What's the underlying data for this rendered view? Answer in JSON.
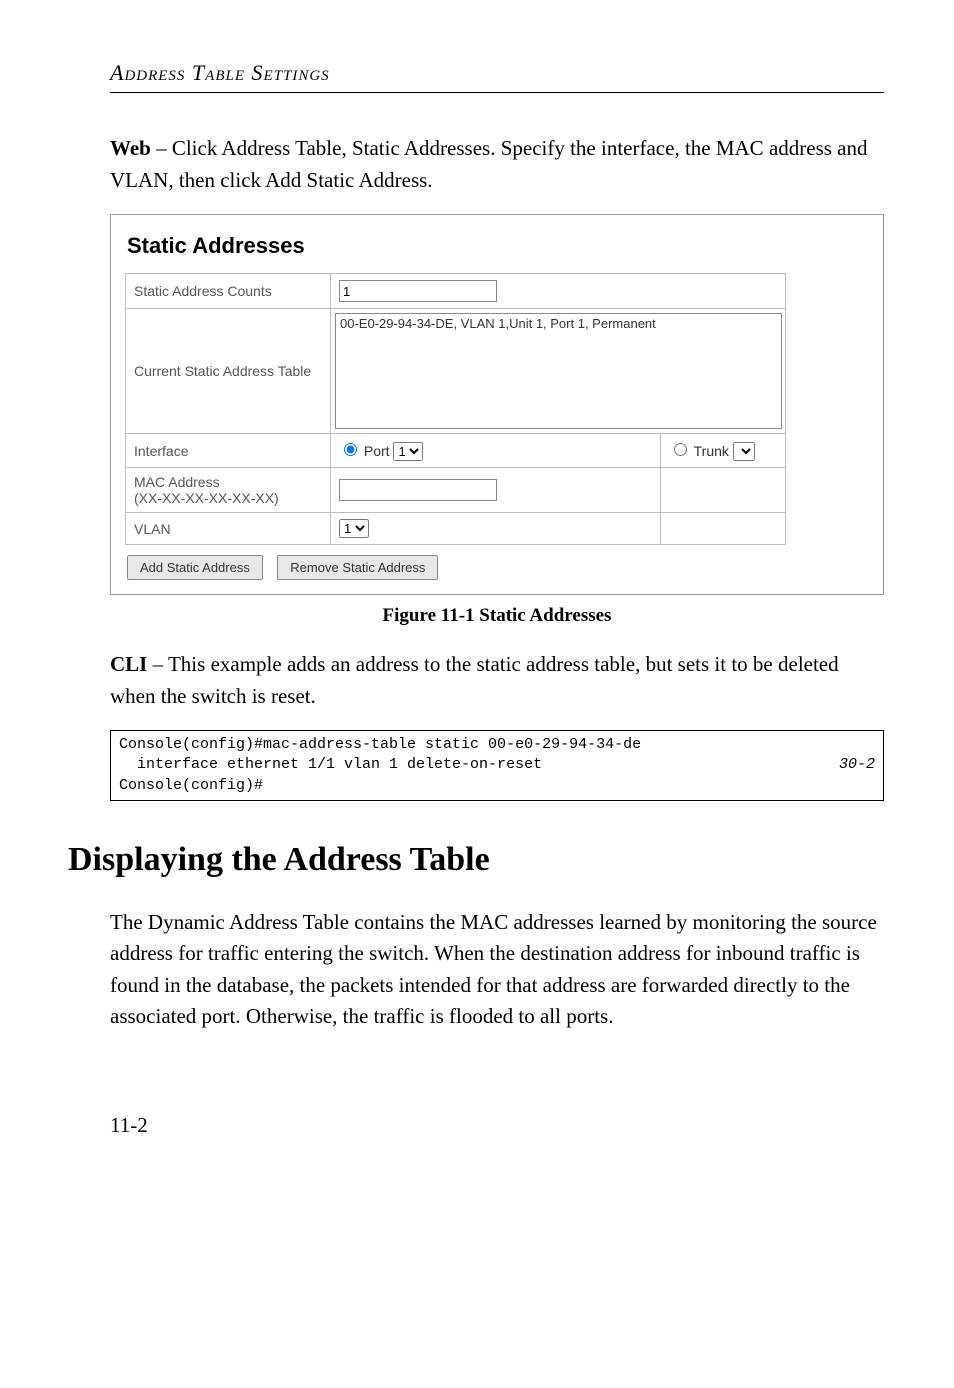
{
  "header": {
    "section_title": "Address Table Settings"
  },
  "intro": {
    "web_label": "Web",
    "web_text": " – Click Address Table, Static Addresses. Specify the interface, the MAC address and VLAN, then click Add Static Address."
  },
  "screenshot": {
    "title": "Static Addresses",
    "rows": {
      "static_count_label": "Static Address Counts",
      "static_count_value": "1",
      "current_table_label": "Current Static Address Table",
      "current_table_value": "00-E0-29-94-34-DE, VLAN 1,Unit 1, Port 1, Permanent",
      "interface_label": "Interface",
      "port_label": "Port",
      "port_value": "1",
      "trunk_label": "Trunk",
      "mac_label": "MAC Address",
      "mac_hint": "(XX-XX-XX-XX-XX-XX)",
      "mac_value": "",
      "vlan_label": "VLAN",
      "vlan_value": "1"
    },
    "buttons": {
      "add": "Add Static Address",
      "remove": "Remove Static Address"
    }
  },
  "figure_caption": "Figure 11-1  Static Addresses",
  "cli": {
    "label": "CLI",
    "text": " – This example adds an address to the static address table, but sets it to be deleted when the switch is reset."
  },
  "code": {
    "line1": "Console(config)#mac-address-table static 00-e0-29-94-34-de",
    "line2": "  interface ethernet 1/1 vlan 1 delete-on-reset",
    "ref": "30-2",
    "line3": "Console(config)#"
  },
  "h1": "Displaying the Address Table",
  "para": "The Dynamic Address Table contains the MAC addresses learned by monitoring the source address for traffic entering the switch. When the destination address for inbound traffic is found in the database, the packets intended for that address are forwarded directly to the associated port. Otherwise, the traffic is flooded to all ports.",
  "page_num": "11-2"
}
